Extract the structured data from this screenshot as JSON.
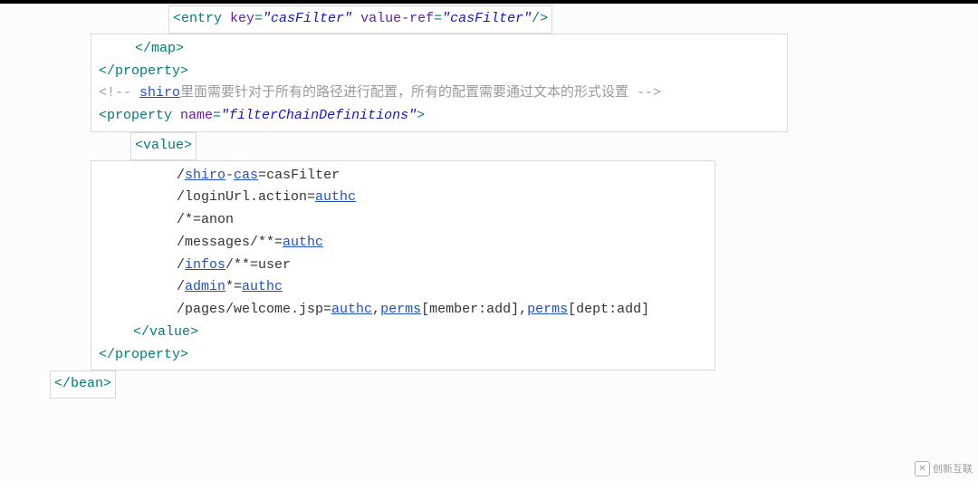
{
  "line1": {
    "open": "<entry",
    "attr1": " key",
    "eq1": "=",
    "val1": "\"casFilter\"",
    "attr2": " value-ref",
    "eq2": "=",
    "val2": "\"casFilter\"",
    "close": "/>"
  },
  "block1": {
    "l1": "</map>",
    "l2": "</property>",
    "cmt_open": "<!-- ",
    "cmt_link": "shiro",
    "cmt_rest": "里面需要针对于所有的路径进行配置，所有的配置需要通过文本的形式设置 -->",
    "p_open": "<property",
    "p_attr": " name",
    "p_eq": "=",
    "p_val": "\"filterChainDefinitions\"",
    "p_close": ">"
  },
  "value_open": "<value>",
  "chain": {
    "l1_a": "/",
    "l1_b": "shiro",
    "l1_c": "-",
    "l1_d": "cas",
    "l1_e": "=casFilter",
    "l2_a": "/loginUrl.action=",
    "l2_b": "authc",
    "l3": "/*=anon",
    "l4_a": "/messages/**=",
    "l4_b": "authc",
    "l5_a": "/",
    "l5_b": "infos",
    "l5_c": "/**=user",
    "l6_a": "/",
    "l6_b": "admin",
    "l6_c": "*=",
    "l6_d": "authc",
    "l7_a": "/pages/welcome.jsp=",
    "l7_b": "authc",
    "l7_c": ",",
    "l7_d": "perms",
    "l7_e": "[member:add],",
    "l7_f": "perms",
    "l7_g": "[dept:add]",
    "value_close": "</value>",
    "prop_close": "</property>"
  },
  "bean_close": "</bean>",
  "watermark": "创新互联"
}
